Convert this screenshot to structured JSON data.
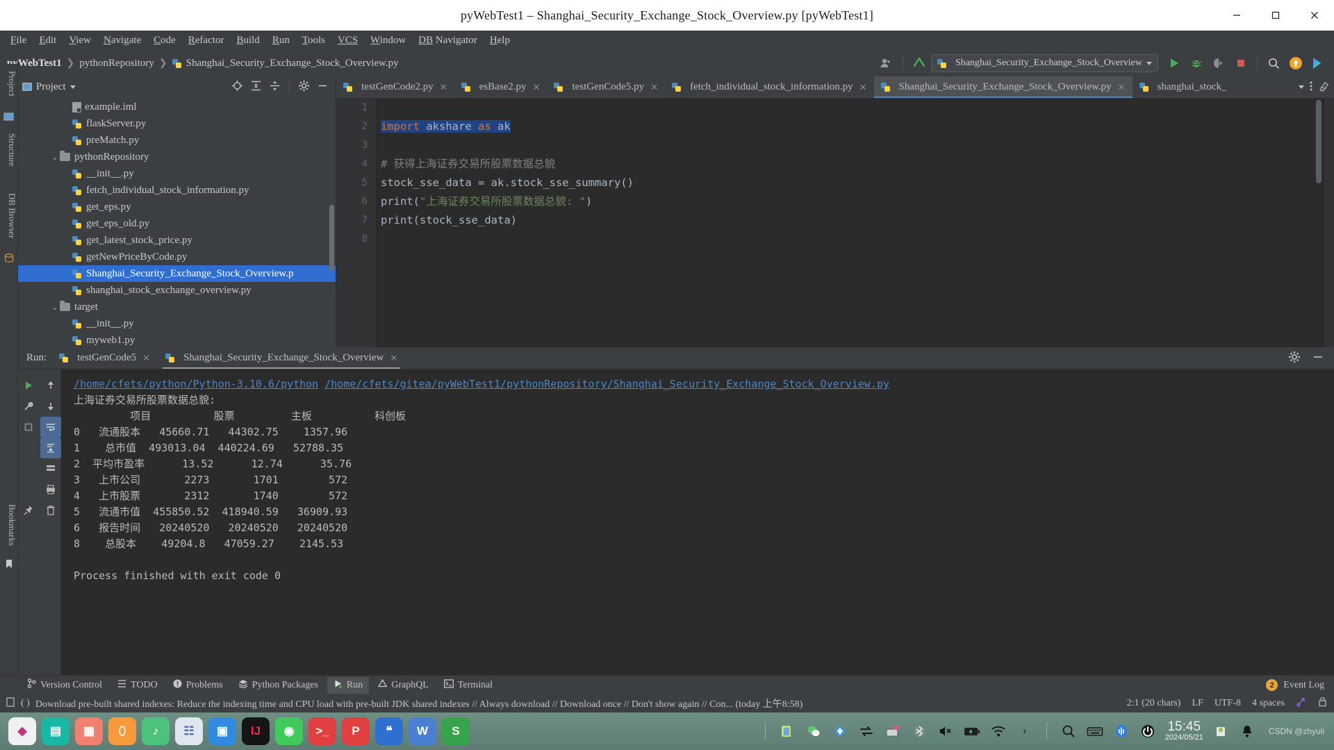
{
  "window": {
    "title": "pyWebTest1  –  Shanghai_Security_Exchange_Stock_Overview.py  [pyWebTest1]",
    "minimize": "−",
    "maximize": "▢",
    "close": "✕"
  },
  "menubar": {
    "items": [
      {
        "mn": "F",
        "rest": "ile"
      },
      {
        "mn": "E",
        "rest": "dit"
      },
      {
        "mn": "V",
        "rest": "iew"
      },
      {
        "mn": "N",
        "rest": "avigate"
      },
      {
        "mn": "C",
        "rest": "ode"
      },
      {
        "mn": "R",
        "rest": "efactor"
      },
      {
        "mn": "B",
        "rest": "uild"
      },
      {
        "mn": "R",
        "rest": "un"
      },
      {
        "mn": "T",
        "rest": "ools"
      },
      {
        "mn": "VCS",
        "rest": ""
      },
      {
        "mn": "W",
        "rest": "indow"
      },
      {
        "mn": "DB",
        "rest": " Navigator"
      },
      {
        "mn": "H",
        "rest": "elp"
      }
    ]
  },
  "breadcrumb": {
    "project": "pyWebTest1",
    "folder": "pythonRepository",
    "file": "Shanghai_Security_Exchange_Stock_Overview.py",
    "separator": "❯"
  },
  "toolbar": {
    "run_config": "Shanghai_Security_Exchange_Stock_Overview",
    "icons": [
      "run-icon",
      "debug-icon",
      "coverage-icon",
      "stop-icon",
      "search-icon",
      "update-project-icon",
      "datagrip-icon"
    ],
    "account_icon": "user-account-icon",
    "vcs_icon": "vcs-update-icon"
  },
  "editor_tabs": [
    {
      "label": "testGenCode2.py",
      "active": false
    },
    {
      "label": "esBase2.py",
      "active": false
    },
    {
      "label": "testGenCode5.py",
      "active": false
    },
    {
      "label": "fetch_individual_stock_information.py",
      "active": false
    },
    {
      "label": "Shanghai_Security_Exchange_Stock_Overview.py",
      "active": true
    },
    {
      "label": "shanghai_stock_",
      "active": false
    }
  ],
  "left_strip": {
    "labels": [
      "Project",
      "Structure",
      "DB Browser",
      "Bookmarks"
    ]
  },
  "project_panel": {
    "title": "Project",
    "header_icons": [
      "locate-icon",
      "expand-all-icon",
      "collapse-all-icon",
      "gear-icon",
      "hide-icon"
    ],
    "tree": [
      {
        "label": "example.iml",
        "indent": 3,
        "type": "iml",
        "chev": "",
        "selected": false
      },
      {
        "label": "flaskServer.py",
        "indent": 3,
        "type": "py",
        "chev": "",
        "selected": false
      },
      {
        "label": "preMatch.py",
        "indent": 3,
        "type": "py",
        "chev": "",
        "selected": false
      },
      {
        "label": "pythonRepository",
        "indent": 2,
        "type": "folder",
        "chev": "⌄",
        "selected": false
      },
      {
        "label": "__init__.py",
        "indent": 3,
        "type": "py",
        "chev": "",
        "selected": false
      },
      {
        "label": "fetch_individual_stock_information.py",
        "indent": 3,
        "type": "py",
        "chev": "",
        "selected": false
      },
      {
        "label": "get_eps.py",
        "indent": 3,
        "type": "py",
        "chev": "",
        "selected": false
      },
      {
        "label": "get_eps_old.py",
        "indent": 3,
        "type": "py",
        "chev": "",
        "selected": false
      },
      {
        "label": "get_latest_stock_price.py",
        "indent": 3,
        "type": "py",
        "chev": "",
        "selected": false
      },
      {
        "label": "getNewPriceByCode.py",
        "indent": 3,
        "type": "py",
        "chev": "",
        "selected": false
      },
      {
        "label": "Shanghai_Security_Exchange_Stock_Overview.p",
        "indent": 3,
        "type": "py",
        "chev": "",
        "selected": true
      },
      {
        "label": "shanghai_stock_exchange_overview.py",
        "indent": 3,
        "type": "py",
        "chev": "",
        "selected": false
      },
      {
        "label": "target",
        "indent": 2,
        "type": "folder",
        "chev": "⌄",
        "selected": false
      },
      {
        "label": "__init__.py",
        "indent": 3,
        "type": "py",
        "chev": "",
        "selected": false
      },
      {
        "label": "myweb1.py",
        "indent": 3,
        "type": "py",
        "chev": "",
        "selected": false
      }
    ]
  },
  "editor": {
    "line_numbers": [
      "1",
      "2",
      "3",
      "4",
      "5",
      "6",
      "7",
      "8"
    ],
    "lines": [
      {
        "n": 1,
        "segments": []
      },
      {
        "n": 2,
        "segments": [
          {
            "t": "import",
            "c": "kw",
            "hl": true
          },
          {
            "t": " akshare ",
            "c": "plain",
            "hl": true
          },
          {
            "t": "as",
            "c": "kw",
            "hl": true
          },
          {
            "t": " ak",
            "c": "plain",
            "hl": true
          }
        ]
      },
      {
        "n": 3,
        "segments": []
      },
      {
        "n": 4,
        "segments": [
          {
            "t": "# 获得上海证券交易所股票数据总貌",
            "c": "cmt",
            "hl": false
          }
        ]
      },
      {
        "n": 5,
        "segments": [
          {
            "t": "stock_sse_data = ak.stock_sse_summary()",
            "c": "plain",
            "hl": false
          }
        ]
      },
      {
        "n": 6,
        "segments": [
          {
            "t": "print",
            "c": "fn",
            "hl": false
          },
          {
            "t": "(",
            "c": "plain",
            "hl": false
          },
          {
            "t": "\"上海证券交易所股票数据总貌: \"",
            "c": "str",
            "hl": false
          },
          {
            "t": ")",
            "c": "plain",
            "hl": false
          }
        ]
      },
      {
        "n": 7,
        "segments": [
          {
            "t": "print",
            "c": "fn",
            "hl": false
          },
          {
            "t": "(stock_sse_data)",
            "c": "plain",
            "hl": false
          }
        ]
      },
      {
        "n": 8,
        "segments": []
      }
    ]
  },
  "run_panel": {
    "label": "Run:",
    "tabs": [
      {
        "label": "testGenCode5",
        "active": false
      },
      {
        "label": "Shanghai_Security_Exchange_Stock_Overview",
        "active": true
      }
    ],
    "header_icons": [
      "gear-icon",
      "hide-icon"
    ],
    "sidebar_icons": [
      "rerun-icon",
      "up-arrow-icon",
      "wrench-icon",
      "down-arrow-icon",
      "stop-icon",
      "soft-wrap-icon",
      "scroll-to-end-icon",
      "print-icon",
      "clear-all-icon",
      "pin-icon",
      "trash-icon"
    ],
    "console": {
      "command_paths": [
        "/home/cfets/python/Python-3.10.6/python",
        "/home/cfets/gitea/pyWebTest1/pythonRepository/Shanghai_Security_Exchange_Stock_Overview.py"
      ],
      "heading": "上海证券交易所股票数据总貌:",
      "table_header": "         项目          股票         主板          科创板",
      "rows": [
        "0   流通股本   45660.71   44302.75    1357.96",
        "1    总市值  493013.04  440224.69   52788.35",
        "2  平均市盈率      13.52      12.74      35.76",
        "3   上市公司       2273       1701        572",
        "4   上市股票       2312       1740        572",
        "5   流通市值  455850.52  418940.59   36909.93",
        "6   报告时间   20240520   20240520   20240520",
        "8    总股本    49204.8   47059.27    2145.53"
      ],
      "blank": " ",
      "exit_message": "Process finished with exit code 0"
    }
  },
  "bottom_toolbar": {
    "items": [
      {
        "label": "Version Control",
        "icon": "branch-icon",
        "active": false
      },
      {
        "label": "TODO",
        "icon": "list-icon",
        "active": false
      },
      {
        "label": "Problems",
        "icon": "warning-icon",
        "active": false
      },
      {
        "label": "Python Packages",
        "icon": "packages-icon",
        "active": false
      },
      {
        "label": "Run",
        "icon": "run-icon",
        "active": true
      },
      {
        "label": "GraphQL",
        "icon": "graphql-icon",
        "active": false
      },
      {
        "label": "Terminal",
        "icon": "terminal-icon",
        "active": false
      }
    ],
    "event_log": {
      "label": "Event Log",
      "count": "2"
    }
  },
  "statusbar": {
    "message": "Download pre-built shared indexes: Reduce the indexing time and CPU load with pre-built JDK shared indexes // Always download // Download once // Don't show again // Con... (today 上午8:58)",
    "caret": "2:1 (20 chars)",
    "line_sep": "LF",
    "encoding": "UTF-8",
    "indent": "4 spaces",
    "icons": [
      "python-console-icon",
      "lock-icon"
    ]
  },
  "taskbar": {
    "apps": [
      {
        "name": "app-launcher-icon",
        "glyph": "◆",
        "bg": "#eef0f2",
        "fg": "#c3337a",
        "active": false
      },
      {
        "name": "files-icon",
        "glyph": "▤",
        "bg": "#17b8a6",
        "fg": "#ffffff",
        "active": false
      },
      {
        "name": "calculator-icon",
        "glyph": "▦",
        "bg": "#f08070",
        "fg": "#ffffff",
        "active": false
      },
      {
        "name": "app-store-icon",
        "glyph": "⬯",
        "bg": "#f79a3c",
        "fg": "#ffffff",
        "active": false
      },
      {
        "name": "music-icon",
        "glyph": "♪",
        "bg": "#4cc27c",
        "fg": "#ffffff",
        "active": false
      },
      {
        "name": "contacts-icon",
        "glyph": "☷",
        "bg": "#dfe6ef",
        "fg": "#4a6ea8",
        "active": false
      },
      {
        "name": "trash-icon",
        "glyph": "▣",
        "bg": "#2f8ae0",
        "fg": "#ffffff",
        "active": true
      },
      {
        "name": "intellij-idea-icon",
        "glyph": "IJ",
        "bg": "#151515",
        "fg": "#fe2857",
        "active": true
      },
      {
        "name": "wechat-icon",
        "glyph": "◉",
        "bg": "#3fca5b",
        "fg": "#ffffff",
        "active": true
      },
      {
        "name": "terminal-icon",
        "glyph": ">_",
        "bg": "#e0403f",
        "fg": "#ffffff",
        "active": true
      },
      {
        "name": "pycharm-icon",
        "glyph": "P",
        "bg": "#e0403f",
        "fg": "#ffffff",
        "active": true
      },
      {
        "name": "document-icon",
        "glyph": "❝",
        "bg": "#2f6fd0",
        "fg": "#ffffff",
        "active": true
      },
      {
        "name": "wps-writer-icon",
        "glyph": "W",
        "bg": "#4a7fd4",
        "fg": "#ffffff",
        "active": true
      },
      {
        "name": "wps-sheet-icon",
        "glyph": "S",
        "bg": "#37a34a",
        "fg": "#ffffff",
        "active": true
      }
    ],
    "tray": [
      "screenshot-icon",
      "wechat-tray-icon",
      "sogou-icon",
      "network-transfer-icon",
      "input-method-icon",
      "bluetooth-icon",
      "volume-muted-icon",
      "battery-charging-icon",
      "wifi-icon",
      "expand-tray-icon"
    ],
    "tray2": [
      "search-icon",
      "keyboard-icon",
      "sound-icon",
      "power-icon"
    ],
    "clock": {
      "time": "15:45",
      "date": "2024/05/21"
    },
    "watermark": "CSDN @zhyuli"
  }
}
